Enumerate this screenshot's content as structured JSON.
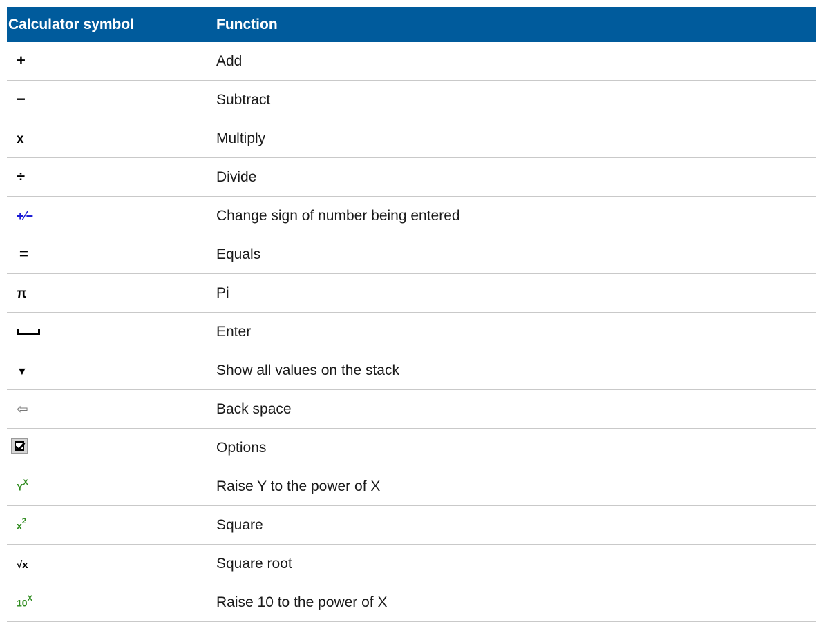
{
  "table": {
    "headers": {
      "symbol": "Calculator symbol",
      "function": "Function"
    },
    "rows": [
      {
        "symbol": "+",
        "icon": "plus-icon",
        "function": "Add"
      },
      {
        "symbol": "−",
        "icon": "minus-icon",
        "function": "Subtract"
      },
      {
        "symbol": "x",
        "icon": "multiply-icon",
        "function": "Multiply"
      },
      {
        "symbol": "÷",
        "icon": "divide-icon",
        "function": "Divide"
      },
      {
        "symbol": "+⁄−",
        "icon": "change-sign-icon",
        "function": "Change sign of number being entered"
      },
      {
        "symbol": "=",
        "icon": "equals-icon",
        "function": "Equals"
      },
      {
        "symbol": "π",
        "icon": "pi-icon",
        "function": "Pi"
      },
      {
        "symbol": "",
        "icon": "enter-icon",
        "function": "Enter"
      },
      {
        "symbol": "▼",
        "icon": "show-stack-icon",
        "function": "Show all values on the stack"
      },
      {
        "symbol": "⇦",
        "icon": "back-space-icon",
        "function": "Back space"
      },
      {
        "symbol": "",
        "icon": "options-checkbox-icon",
        "function": "Options"
      },
      {
        "symbol": "Y",
        "sup": "X",
        "icon": "y-power-x-icon",
        "function": "Raise Y to the power of X"
      },
      {
        "symbol": "x",
        "sup": "2",
        "icon": "square-icon",
        "function": "Square"
      },
      {
        "symbol": "√x",
        "icon": "square-root-icon",
        "function": "Square root"
      },
      {
        "symbol": "10",
        "sup": "X",
        "icon": "ten-power-x-icon",
        "function": "Raise 10 to the power of X"
      }
    ]
  },
  "colors": {
    "header_bg": "#005b9c",
    "header_text": "#ffffff",
    "row_border": "#c9c9c9",
    "blue_symbol": "#1a1ad6",
    "green_symbol": "#2e8b1e"
  }
}
